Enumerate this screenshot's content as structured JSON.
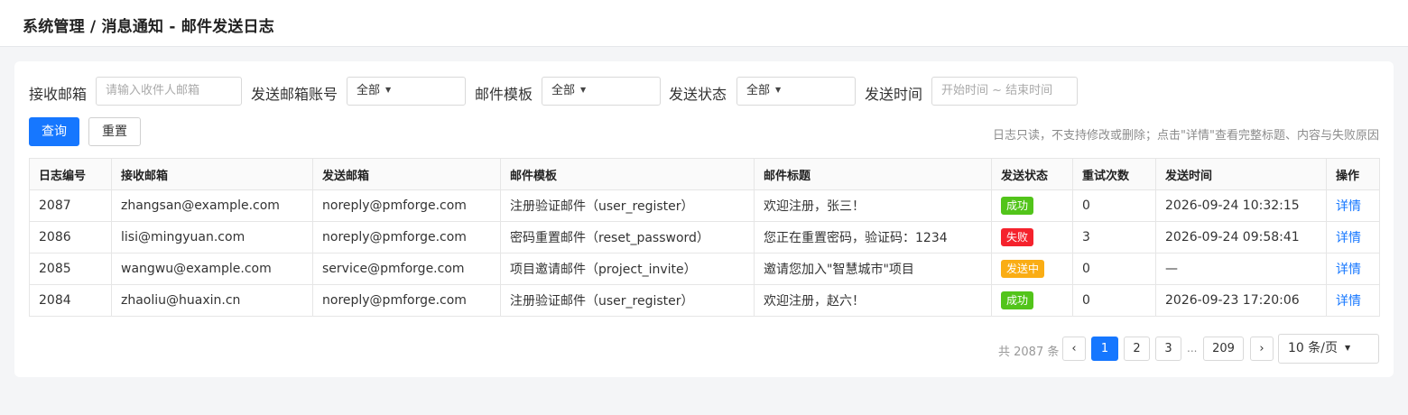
{
  "breadcrumb": "系统管理 / 消息通知 - 邮件发送日志",
  "filters": {
    "recipient_label": "接收邮箱",
    "recipient_placeholder": "请输入收件人邮箱",
    "sender_label": "发送邮箱账号",
    "sender_value": "全部",
    "template_label": "邮件模板",
    "template_value": "全部",
    "status_label": "发送状态",
    "status_value": "全部",
    "time_label": "发送时间",
    "time_placeholder": "开始时间 ~ 结束时间"
  },
  "actions": {
    "query_label": "查询",
    "reset_label": "重置",
    "hint": "日志只读，不支持修改或删除；点击\"详情\"查看完整标题、内容与失败原因"
  },
  "table": {
    "columns": [
      "日志编号",
      "接收邮箱",
      "发送邮箱",
      "邮件模板",
      "邮件标题",
      "发送状态",
      "重试次数",
      "发送时间",
      "操作"
    ],
    "rows": [
      {
        "id": "2087",
        "to": "zhangsan@example.com",
        "from": "noreply@pmforge.com",
        "template": "注册验证邮件（user_register）",
        "subject": "欢迎注册，张三！",
        "status": "成功",
        "status_kind": "success",
        "retries": "0",
        "time": "2026-09-24 10:32:15",
        "action": "详情"
      },
      {
        "id": "2086",
        "to": "lisi@mingyuan.com",
        "from": "noreply@pmforge.com",
        "template": "密码重置邮件（reset_password）",
        "subject": "您正在重置密码，验证码：1234",
        "status": "失败",
        "status_kind": "fail",
        "retries": "3",
        "time": "2026-09-24 09:58:41",
        "action": "详情"
      },
      {
        "id": "2085",
        "to": "wangwu@example.com",
        "from": "service@pmforge.com",
        "template": "项目邀请邮件（project_invite）",
        "subject": "邀请您加入\"智慧城市\"项目",
        "status": "发送中",
        "status_kind": "sending",
        "retries": "0",
        "time": "—",
        "action": "详情"
      },
      {
        "id": "2084",
        "to": "zhaoliu@huaxin.cn",
        "from": "noreply@pmforge.com",
        "template": "注册验证邮件（user_register）",
        "subject": "欢迎注册，赵六！",
        "status": "成功",
        "status_kind": "success",
        "retries": "0",
        "time": "2026-09-23 17:20:06",
        "action": "详情"
      }
    ]
  },
  "pagination": {
    "total_text": "共 2087 条",
    "prev": "‹",
    "pages": [
      "1",
      "2",
      "3"
    ],
    "ellipsis": "...",
    "last": "209",
    "next": "›",
    "current": "1",
    "page_size": "10 条/页"
  },
  "colors": {
    "primary": "#1677ff",
    "success": "#52c41a",
    "fail": "#f5222d",
    "sending": "#faad14"
  }
}
